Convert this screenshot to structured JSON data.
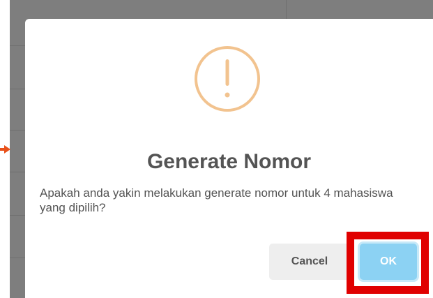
{
  "dialog": {
    "icon": "warning-icon",
    "title": "Generate Nomor",
    "message": "Apakah anda yakin melakukan generate nomor untuk 4 mahasiswa yang dipilih?",
    "cancel_label": "Cancel",
    "ok_label": "OK"
  },
  "colors": {
    "icon": "#f2c38f",
    "ok_button": "#8cd2f3",
    "cancel_button": "#eeeeee",
    "annotation_highlight": "#e00000",
    "annotation_arrow": "#e8501a"
  }
}
